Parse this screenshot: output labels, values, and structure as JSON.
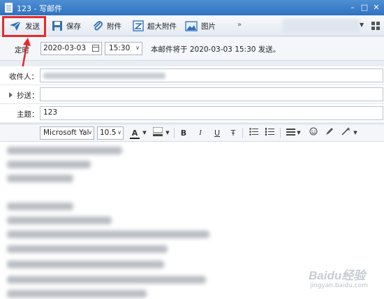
{
  "window": {
    "title": "123 - 写邮件",
    "minimize": "–",
    "maximize": "□",
    "close": "✕"
  },
  "toolbar": {
    "send": "发送",
    "save": "保存",
    "attach": "附件",
    "large_attach": "超大附件",
    "image": "图片",
    "more": "»"
  },
  "schedule": {
    "label": "定时",
    "date": "2020-03-03",
    "time": "15:30",
    "note": "本邮件将于 2020-03-03 15:30 发送。"
  },
  "fields": {
    "to_label": "收件人：",
    "cc_label": "抄送：",
    "subject_label": "主题：",
    "subject_value": "123"
  },
  "format": {
    "font": "Microsoft Yal",
    "size": "10.5",
    "font_color": "A",
    "bold": "B",
    "italic": "I",
    "underline": "U",
    "strike": "Ŧ"
  },
  "watermark": {
    "brand": "Baidu经验",
    "url": "jingyan.baidu.com"
  },
  "colors": {
    "titlebar": "#3b7fc8",
    "highlight": "#e12b2b",
    "icon_blue": "#2f6fb6"
  }
}
